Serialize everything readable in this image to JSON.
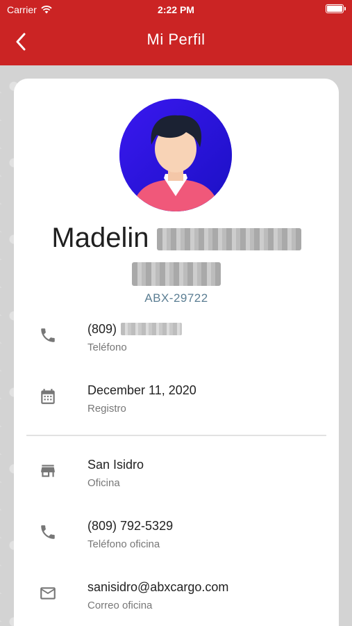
{
  "status_bar": {
    "carrier": "Carrier",
    "time": "2:22 PM"
  },
  "nav": {
    "title": "Mi Perfil"
  },
  "profile": {
    "first_name": "Madelin",
    "code": "ABX-29722"
  },
  "info": [
    {
      "icon": "phone-icon",
      "value": "(809)",
      "label": "Teléfono"
    },
    {
      "icon": "calendar-icon",
      "value": "December 11, 2020",
      "label": "Registro"
    },
    {
      "icon": "store-icon",
      "value": "San Isidro",
      "label": "Oficina"
    },
    {
      "icon": "phone-icon",
      "value": "(809) 792-5329",
      "label": "Teléfono oficina"
    },
    {
      "icon": "mail-icon",
      "value": "sanisidro@abxcargo.com",
      "label": "Correo oficina"
    }
  ],
  "colors": {
    "header": "#cb2424",
    "code": "#5b7e93",
    "avatar_bg": "#2a14e6"
  }
}
